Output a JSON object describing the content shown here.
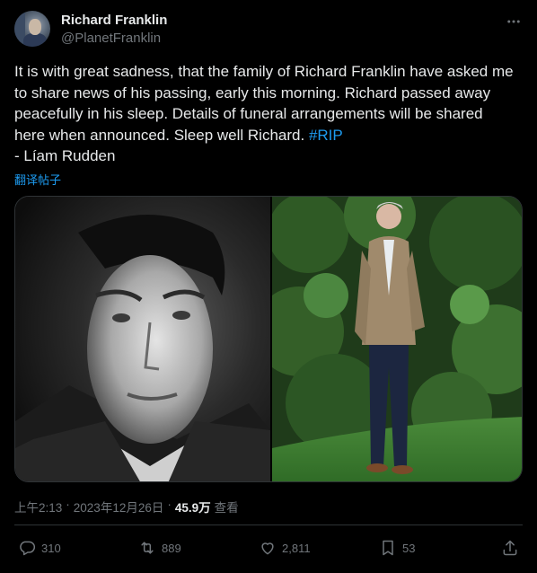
{
  "user": {
    "name": "Richard Franklin",
    "handle": "@PlanetFranklin"
  },
  "tweet": {
    "text": "It is with great sadness, that the family of Richard Franklin have asked me to share news of his passing, early this morning. Richard passed away peacefully in his sleep. Details of funeral arrangements will be shared here when announced. Sleep well Richard. ",
    "hashtag": "#RIP",
    "signature": "- Líam Rudden",
    "translate_label": "翻译帖子"
  },
  "meta": {
    "time": "上午2:13",
    "separator1": "·",
    "date": "2023年12月26日",
    "separator2": "·",
    "views_count": "45.9万",
    "views_label": "查看"
  },
  "actions": {
    "replies": "310",
    "reposts": "889",
    "likes": "2,811",
    "bookmarks": "53"
  },
  "colors": {
    "background": "#000000",
    "text": "#e7e9ea",
    "muted": "#71767b",
    "accent": "#1d9bf0",
    "border": "#2f3336"
  },
  "icons": [
    "more-icon",
    "reply-icon",
    "repost-icon",
    "like-icon",
    "bookmark-icon",
    "share-icon"
  ]
}
